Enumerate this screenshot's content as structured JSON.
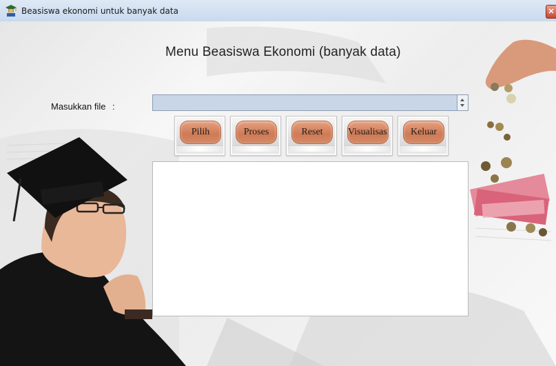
{
  "window": {
    "title": "Beasiswa ekonomi untuk banyak data",
    "close_label": "✕"
  },
  "heading": "Menu Beasiswa Ekonomi (banyak data)",
  "file": {
    "label": "Masukkan file",
    "colon": ":",
    "value": ""
  },
  "buttons": [
    {
      "label": "Pilih"
    },
    {
      "label": "Proses"
    },
    {
      "label": "Reset"
    },
    {
      "label": "Visualisasi"
    },
    {
      "label": "Keluar"
    }
  ],
  "icons": {
    "app": "scholar-icon",
    "close": "close-icon",
    "spin_up": "arrow-up-icon",
    "spin_down": "arrow-down-icon"
  },
  "colors": {
    "button_face": "#d58863",
    "input_bg": "#c9d6e8",
    "titlebar": "#d6e2f1",
    "close": "#c7462f"
  }
}
